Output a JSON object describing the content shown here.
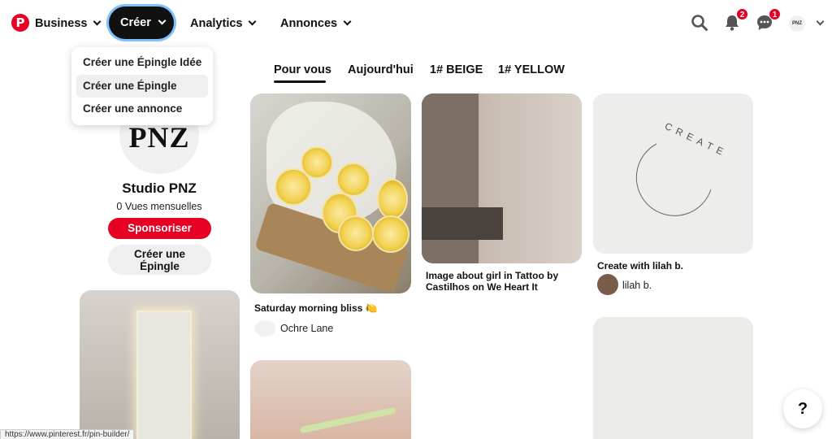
{
  "nav": {
    "business_label": "Business",
    "creer_label": "Créer",
    "analytics_label": "Analytics",
    "annonces_label": "Annonces",
    "notifications_count": "2",
    "messages_count": "1",
    "account_initials": "PNZ"
  },
  "dropdown": {
    "items": [
      "Créer une Épingle Idée",
      "Créer une Épingle",
      "Créer une annonce"
    ]
  },
  "tabs": [
    "Pour vous",
    "Aujourd'hui",
    "1# BEIGE",
    "1# YELLOW"
  ],
  "profile": {
    "avatar_text": "PNZ",
    "name": "Studio PNZ",
    "views": "0 Vues mensuelles",
    "sponsor_label": "Sponsoriser",
    "create_pin_line1": "Créer une",
    "create_pin_line2": "Épingle"
  },
  "pins": {
    "lemons": {
      "title": "Saturday morning bliss 🍋",
      "author": "Ochre Lane"
    },
    "girl": {
      "title_line1": "Image about girl in Tattoo by",
      "title_line2": "Castilhos on We Heart It"
    },
    "create": {
      "image_text": "CREATE",
      "title": "Create with lilah b.",
      "author": "lilah b."
    }
  },
  "help_label": "?",
  "status_url": "https://www.pinterest.fr/pin-builder/",
  "colors": {
    "brand": "#e60023",
    "focus_ring": "#7fc1ff"
  }
}
